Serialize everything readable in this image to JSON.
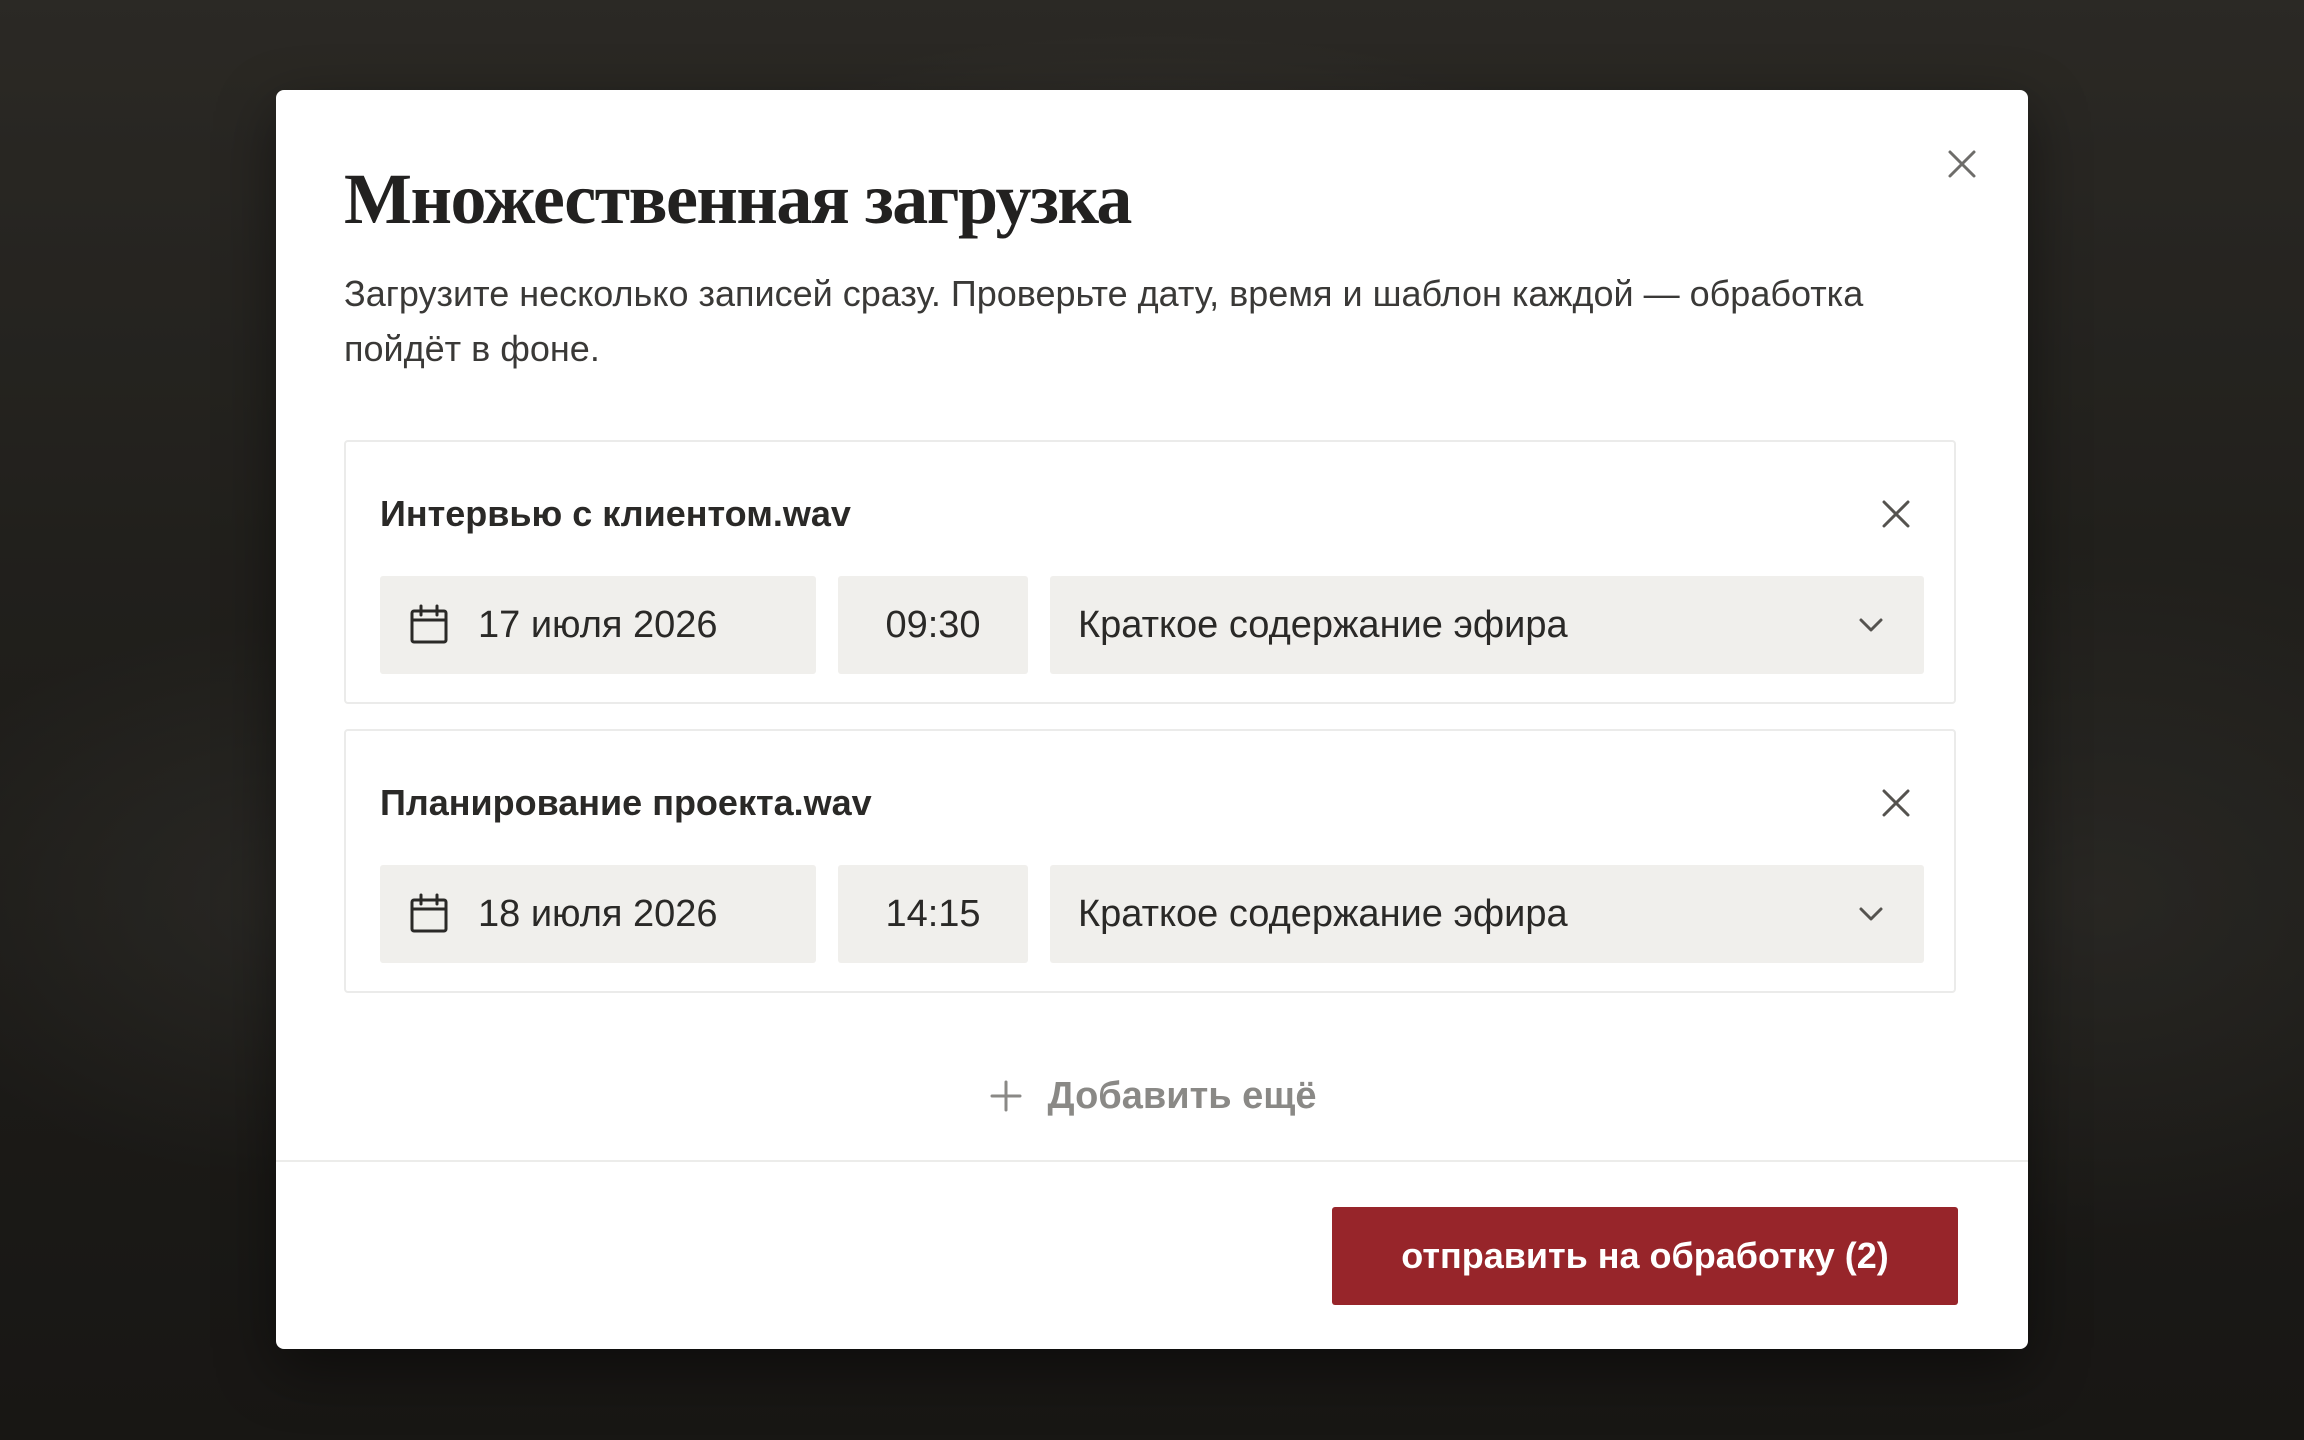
{
  "modal": {
    "title": "Множественная загрузка",
    "subtitle": "Загрузите несколько записей сразу. Проверьте дату, время и шаблон каждой — обработка пойдёт в фоне.",
    "close_icon": "close-icon"
  },
  "files": [
    {
      "name": "Интервью с клиентом.wav",
      "date": "17 июля 2026",
      "time": "09:30",
      "template": "Краткое содержание эфира"
    },
    {
      "name": "Планирование проекта.wav",
      "date": "18 июля 2026",
      "time": "14:15",
      "template": "Краткое содержание эфира"
    }
  ],
  "add_more_label": "Добавить ещё",
  "submit_label": "отправить на обработку (2)",
  "colors": {
    "accent": "#97252a",
    "field_bg": "#f0efec",
    "text": "#2a2927",
    "muted": "#8a8986"
  },
  "icons": [
    "close-icon",
    "calendar-icon",
    "chevron-down-icon",
    "plus-icon"
  ]
}
